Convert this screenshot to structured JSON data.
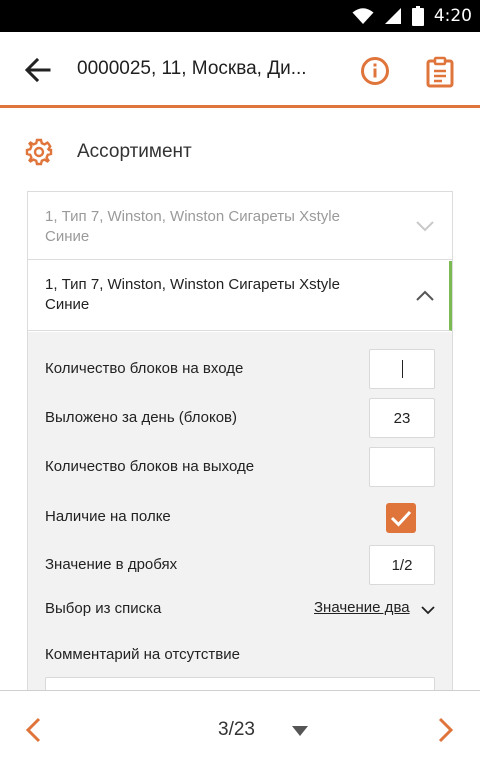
{
  "status_bar": {
    "time": "4:20",
    "icons": [
      "wifi-icon",
      "signal-icon",
      "battery-icon"
    ]
  },
  "app_bar": {
    "title": "0000025, 11, Москва, Ди...",
    "icons": [
      "back-arrow-icon",
      "info-icon",
      "clipboard-icon"
    ]
  },
  "section": {
    "title": "Ассортимент",
    "icon": "gear-icon"
  },
  "items": [
    {
      "label": "1, Тип 7, Winston, Winston Сигареты Xstyle Синие",
      "expanded": false
    },
    {
      "label": "1, Тип 7, Winston, Winston Сигареты Xstyle Синие",
      "expanded": true
    }
  ],
  "form": {
    "blocks_in_label": "Количество блоков на входе",
    "blocks_in_value": "",
    "laid_out_label": "Выложено за день (блоков)",
    "laid_out_value": "23",
    "blocks_out_label": "Количество блоков на выходе",
    "blocks_out_value": "",
    "on_shelf_label": "Наличие на полке",
    "on_shelf_checked": true,
    "fraction_label": "Значение в дробях",
    "fraction_value": "1/2",
    "select_label": "Выбор из списка",
    "select_value": "Значение два",
    "comment_label": "Комментарий на отсутствие",
    "comment_value": ""
  },
  "pager": {
    "text": "3/23"
  },
  "colors": {
    "accent": "#e0753c",
    "active_marker": "#7cba54",
    "status_bar": "#000000"
  }
}
